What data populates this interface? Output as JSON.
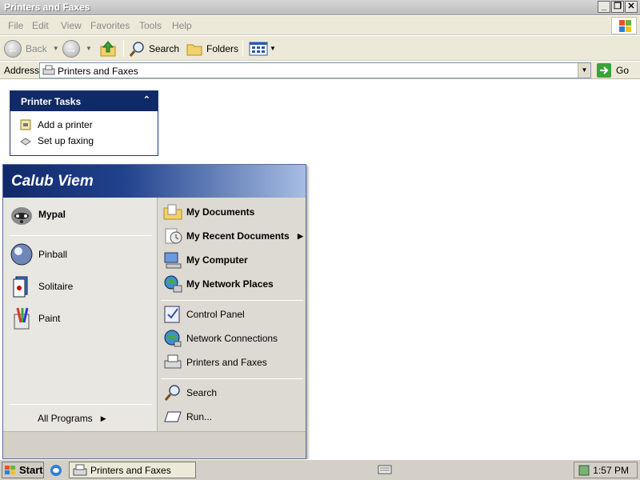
{
  "window": {
    "title": "Printers and Faxes",
    "controls": {
      "minimize": "_",
      "restore": "❐",
      "close": "✕"
    }
  },
  "menubar": {
    "items": [
      "File",
      "Edit",
      "View",
      "Favorites",
      "Tools",
      "Help"
    ]
  },
  "toolbar": {
    "back": "Back",
    "search": "Search",
    "folders": "Folders"
  },
  "address": {
    "label": "Address",
    "value": "Printers and Faxes",
    "go": "Go"
  },
  "printer_tasks": {
    "title": "Printer Tasks",
    "items": [
      "Add a printer",
      "Set up faxing"
    ]
  },
  "start_menu": {
    "user": "Calub Viem",
    "pinned": [
      "Mypal"
    ],
    "recent": [
      "Pinball",
      "Solitaire",
      "Paint"
    ],
    "all_programs": "All Programs",
    "right_top": [
      "My Documents",
      "My Recent Documents",
      "My Computer",
      "My Network Places"
    ],
    "right_mid": [
      "Control Panel",
      "Network Connections",
      "Printers and Faxes"
    ],
    "right_bottom": [
      "Search",
      "Run..."
    ]
  },
  "taskbar": {
    "start": "Start",
    "task": "Printers and Faxes",
    "clock": "1:57 PM"
  },
  "colors": {
    "header_blue": "#0f2a66",
    "taskbar": "#d4d0c8"
  }
}
